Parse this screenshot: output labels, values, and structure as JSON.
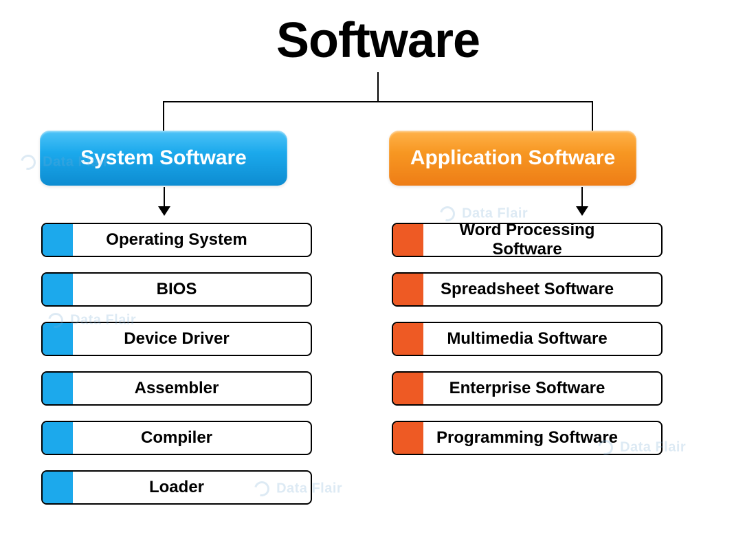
{
  "title": "Software",
  "categories": {
    "system": {
      "label": "System Software",
      "color": "#1ca9ec",
      "items": [
        "Operating System",
        "BIOS",
        "Device Driver",
        "Assembler",
        "Compiler",
        "Loader"
      ]
    },
    "application": {
      "label": "Application Software",
      "color": "#ee5a24",
      "items": [
        "Word Processing Software",
        "Spreadsheet Software",
        "Multimedia Software",
        "Enterprise Software",
        "Programming Software"
      ]
    }
  },
  "watermark": "Data Flair"
}
